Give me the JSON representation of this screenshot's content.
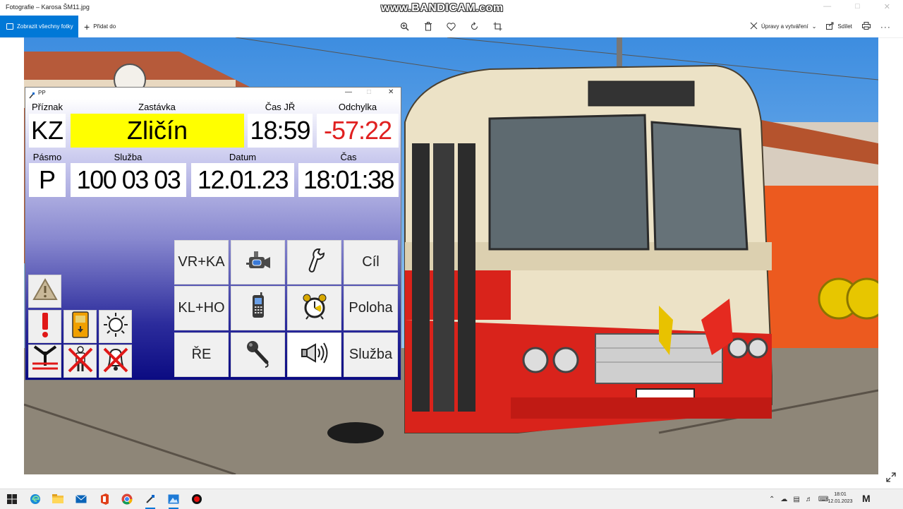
{
  "app": {
    "window_title": "Fotografie – Karosa ŠM11.jpg",
    "watermark": "www.BANDICAM.com"
  },
  "toolbar": {
    "view_all_label": "Zobrazit všechny fotky",
    "add_to_label": "Přidat do",
    "edit_create_label": "Úpravy a vytváření",
    "share_label": "Sdílet"
  },
  "pp_window": {
    "title": "PP",
    "header_labels": {
      "priznak": "Příznak",
      "zastavka": "Zastávka",
      "cas_jr": "Čas JŘ",
      "odchylka": "Odchylka",
      "pasmo": "Pásmo",
      "sluzba": "Služba",
      "datum": "Datum",
      "cas": "Čas"
    },
    "values": {
      "priznak": "KZ",
      "zastavka": "Zličín",
      "cas_jr": "18:59",
      "odchylka": "-57:22",
      "pasmo": "P",
      "sluzba": "100 03 03",
      "datum": "12.01.23",
      "cas": "18:01:38"
    },
    "colors": {
      "stop_highlight": "#ffff00",
      "deviation_text": "#e02020",
      "background_top": "#ffffff",
      "background_bottom": "#0b0b82"
    },
    "grid_buttons": [
      {
        "label": "VR+KA"
      },
      {
        "icon": "video-camera-icon"
      },
      {
        "icon": "wrench-icon"
      },
      {
        "label": "Cíl"
      },
      {
        "label": "KL+HO"
      },
      {
        "icon": "mobile-phone-icon"
      },
      {
        "icon": "alarm-clock-icon"
      },
      {
        "label": "Poloha"
      },
      {
        "label": "ŘE"
      },
      {
        "icon": "microphone-icon"
      },
      {
        "icon": "loudspeaker-icon"
      },
      {
        "label": "Služba"
      }
    ],
    "side_icons": [
      "warning-triangle-icon",
      "exclamation-icon",
      "ticket-validator-icon",
      "sun-icon",
      "antenna-crossed-icon",
      "person-crossed-icon",
      "bell-crossed-icon"
    ]
  },
  "taskbar": {
    "clock_time": "18:01",
    "clock_date": "12.01.2023"
  }
}
